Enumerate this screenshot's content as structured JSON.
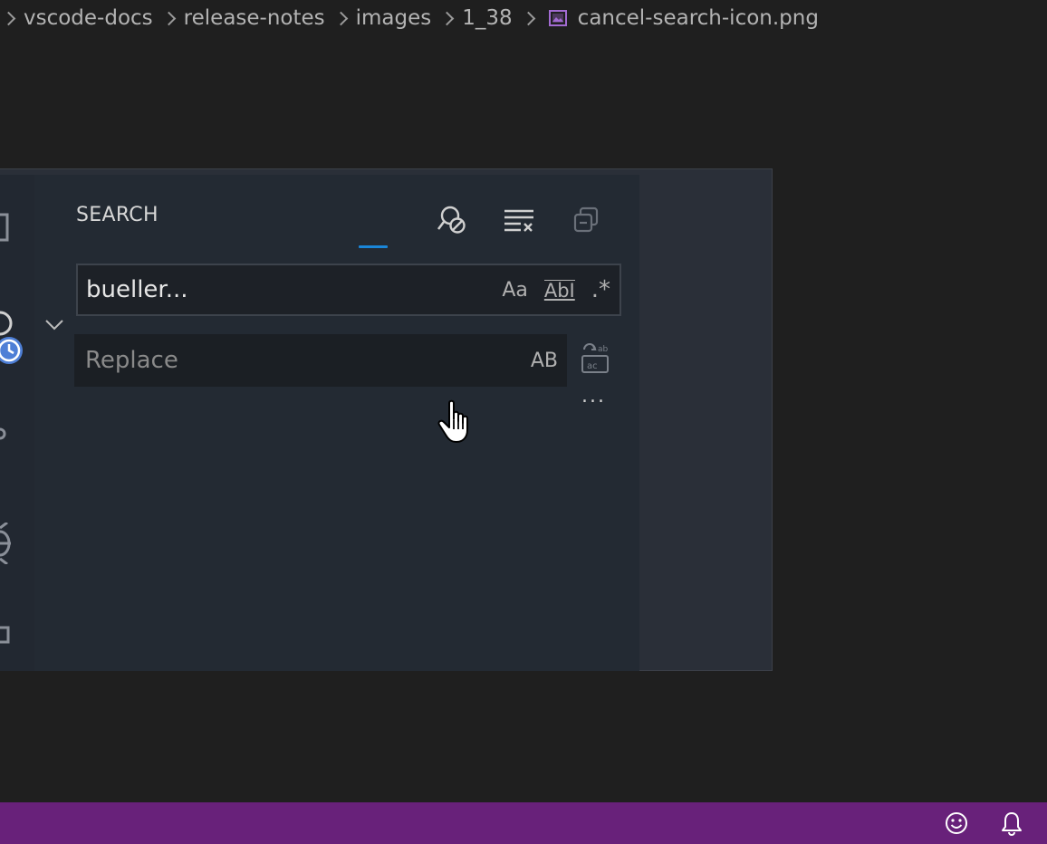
{
  "breadcrumb": {
    "items": [
      "vscode-docs",
      "release-notes",
      "images",
      "1_38"
    ],
    "file": "cancel-search-icon.png"
  },
  "search_view": {
    "title": "SEARCH",
    "search_value": "bueller...",
    "replace_placeholder": "Replace",
    "options": {
      "match_case": "Aa",
      "whole_word": "AbI",
      "regex": ".*",
      "preserve_case": "AB"
    },
    "more_label": "..."
  },
  "colors": {
    "status_bar": "#68217a",
    "accent": "#1a86d8"
  },
  "icons": [
    "chevron-right-icon",
    "image-file-icon",
    "cancel-search-icon",
    "clear-results-icon",
    "collapse-all-icon",
    "chevron-down-icon",
    "replace-all-icon",
    "feedback-smiley-icon",
    "notification-bell-icon"
  ]
}
